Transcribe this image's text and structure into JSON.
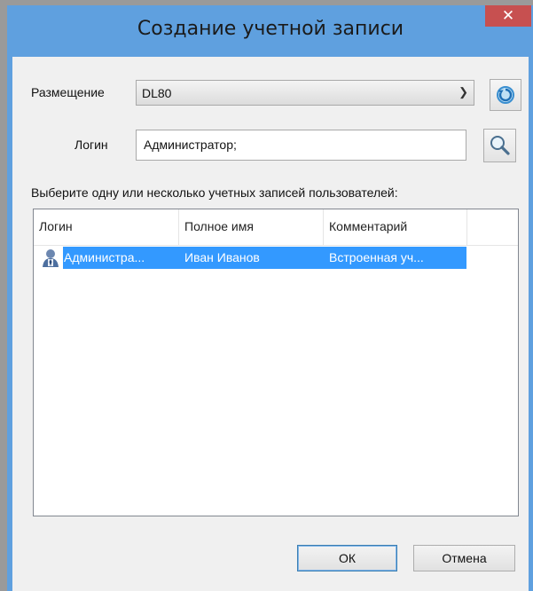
{
  "window": {
    "title": "Создание учетной записи",
    "close_glyph": "✕"
  },
  "form": {
    "location_label": "Размещение",
    "location_value": "DL80",
    "login_label": "Логин",
    "login_value": "Администратор;",
    "instruction": "Выберите одну или несколько учетных записей пользователей:"
  },
  "table": {
    "columns": [
      "Логин",
      "Полное имя",
      "Комментарий"
    ],
    "rows": [
      {
        "login": "Администра...",
        "full_name": "Иван Иванов",
        "comment": "Встроенная уч..."
      }
    ]
  },
  "buttons": {
    "ok": "ОК",
    "cancel": "Отмена"
  },
  "icons": {
    "refresh": "refresh-icon",
    "search": "search-icon",
    "user": "user-icon",
    "dropdown": "chevron-down-icon"
  },
  "colors": {
    "title_bar": "#5fa0df",
    "close_button": "#c75050",
    "selection": "#3399ff"
  }
}
